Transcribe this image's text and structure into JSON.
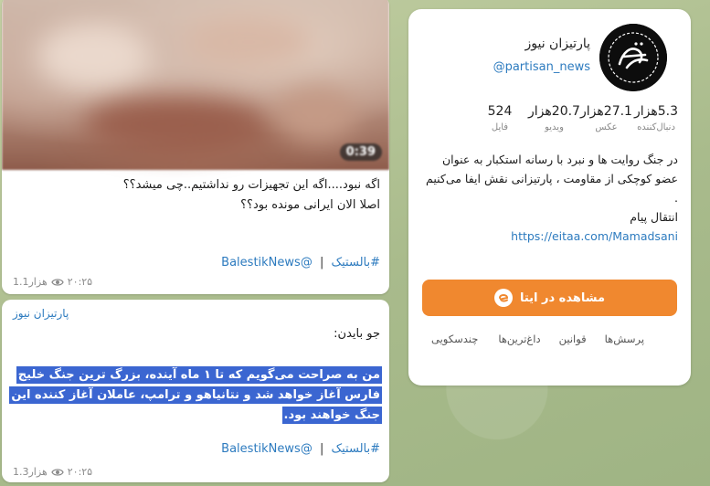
{
  "feed": {
    "message1": {
      "video_duration": "0:39",
      "text": "اگه نبود....اگه این تجهیزات رو نداشتیم..چی میشد؟؟\nاصلا الان ایرانی مونده بود؟؟",
      "tag_handle": "@BalestikNews",
      "tag_separator": "|",
      "tag_hashtag": "#بالستیک",
      "views": "1.1هزار",
      "time": "۲۰:۲۵"
    },
    "message2": {
      "sender": "پارتیزان نیوز",
      "line1": "جو بایدن:",
      "highlight_text": "من به صراحت می‌گویم که تا ۱ ماه آینده، بزرگ ترین جنگ خلیج فارس آغاز خواهد شد و نتانیاهو و ترامپ، عاملان آغاز کننده این جنگ خواهند بود.",
      "tag_handle": "@BalestikNews",
      "tag_separator": "|",
      "tag_hashtag": "#بالستیک",
      "views": "1.3هزار",
      "time": "۲۰:۲۵"
    }
  },
  "channel": {
    "name": "پارتیزان نیوز",
    "handle": "@partisan_news",
    "stats": [
      {
        "value": "5.3هزار",
        "label": "دنبال‌کننده"
      },
      {
        "value": "27.1هزار",
        "label": "عکس"
      },
      {
        "value": "20.7هزار",
        "label": "ویدیو"
      },
      {
        "value": "524",
        "label": "فایل"
      }
    ],
    "description": "در جنگ روایت ها و نبرد با رسانه استکبار به عنوان عضو کوچکی از مقاومت ، پارتیزانی نقش ایفا می‌کنیم",
    "description_dot": ".",
    "forward_label": "انتقال پیام",
    "link": "https://eitaa.com/Mamadsani",
    "view_button_label": "مشاهده در ایتا",
    "tabs": [
      "چندسکویی",
      "داغ‌ترین‌ها",
      "قوانین",
      "پرسش‌ها"
    ]
  },
  "colors": {
    "accent_orange": "#f0882f",
    "link_blue": "#2d7bbf",
    "highlight_blue": "#3b66d1"
  }
}
